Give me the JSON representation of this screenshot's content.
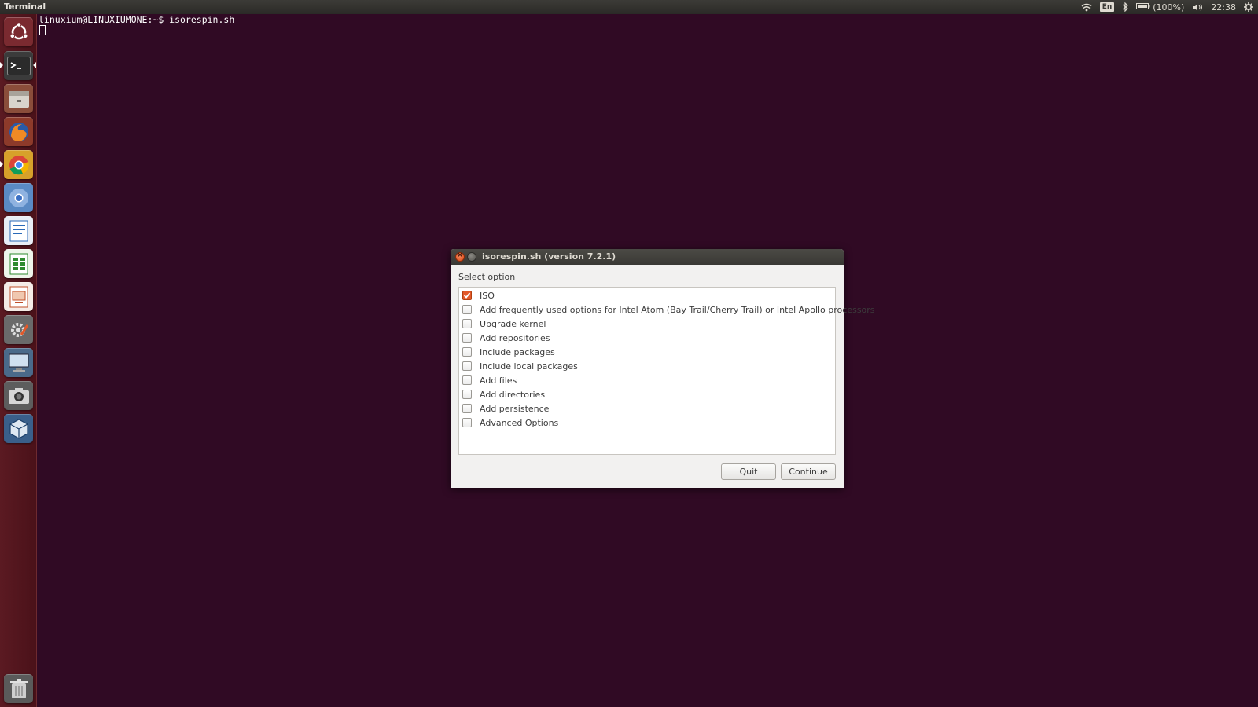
{
  "panel": {
    "app_title": "Terminal",
    "keyboard_layout": "En",
    "battery": "(100%)",
    "clock": "22:38"
  },
  "launcher": {
    "items": [
      {
        "name": "dash-home",
        "icon": "ubuntu-logo-icon"
      },
      {
        "name": "terminal",
        "icon": "terminal-icon",
        "running": true,
        "focused": true
      },
      {
        "name": "files",
        "icon": "file-manager-icon"
      },
      {
        "name": "firefox",
        "icon": "firefox-icon"
      },
      {
        "name": "chrome",
        "icon": "chrome-icon",
        "running": true
      },
      {
        "name": "chromium",
        "icon": "chromium-icon"
      },
      {
        "name": "writer",
        "icon": "libreoffice-writer-icon"
      },
      {
        "name": "calc",
        "icon": "libreoffice-calc-icon"
      },
      {
        "name": "impress",
        "icon": "libreoffice-impress-icon"
      },
      {
        "name": "system-settings",
        "icon": "settings-icon"
      },
      {
        "name": "remote-desktop",
        "icon": "remote-desktop-icon"
      },
      {
        "name": "screenshot",
        "icon": "camera-icon"
      },
      {
        "name": "virtualbox",
        "icon": "virtualbox-icon"
      },
      {
        "name": "trash",
        "icon": "trash-icon"
      }
    ]
  },
  "terminal": {
    "prompt_line": "linuxium@LINUXIUMONE:~$ isorespin.sh"
  },
  "dialog": {
    "title": "isorespin.sh (version 7.2.1)",
    "label": "Select option",
    "options": [
      {
        "label": "ISO",
        "checked": true
      },
      {
        "label": "Add frequently used options for Intel Atom (Bay Trail/Cherry Trail) or Intel Apollo processors",
        "checked": false
      },
      {
        "label": "Upgrade kernel",
        "checked": false
      },
      {
        "label": "Add repositories",
        "checked": false
      },
      {
        "label": "Include packages",
        "checked": false
      },
      {
        "label": "Include local packages",
        "checked": false
      },
      {
        "label": "Add files",
        "checked": false
      },
      {
        "label": "Add directories",
        "checked": false
      },
      {
        "label": "Add persistence",
        "checked": false
      },
      {
        "label": "Advanced Options",
        "checked": false
      }
    ],
    "quit_label": "Quit",
    "continue_label": "Continue"
  },
  "colors": {
    "terminal_bg": "#300a24",
    "accent": "#e2592a",
    "launcher_bg": "#5b1a22"
  }
}
